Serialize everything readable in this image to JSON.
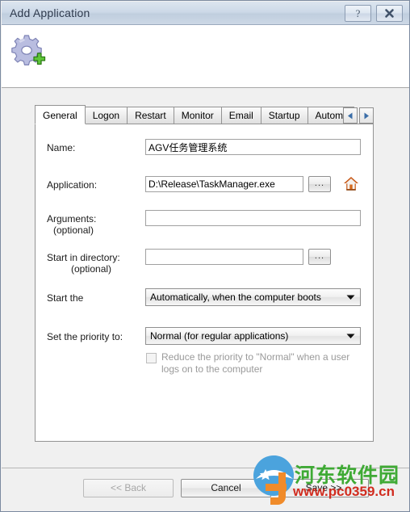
{
  "window": {
    "title": "Add Application",
    "help_button_label": "?",
    "close_button_label": "X",
    "app_icon": "gear-plus-icon"
  },
  "tabs": {
    "items": [
      {
        "label": "General",
        "selected": true
      },
      {
        "label": "Logon",
        "selected": false
      },
      {
        "label": "Restart",
        "selected": false
      },
      {
        "label": "Monitor",
        "selected": false
      },
      {
        "label": "Email",
        "selected": false
      },
      {
        "label": "Startup",
        "selected": false
      },
      {
        "label": "Automate",
        "selected": false
      }
    ],
    "scroll_left_icon": "triangle-left-icon",
    "scroll_right_icon": "triangle-right-icon"
  },
  "form": {
    "name": {
      "label": "Name:",
      "value": "AGV任务管理系统",
      "placeholder": ""
    },
    "application": {
      "label": "Application:",
      "value": "D:\\Release\\TaskManager.exe",
      "placeholder": "",
      "browse_label": "...",
      "home_icon": "home-icon"
    },
    "arguments": {
      "label": "Arguments:",
      "sub_label": "(optional)",
      "value": "",
      "placeholder": ""
    },
    "start_in_directory": {
      "label": "Start in directory:",
      "sub_label": "(optional)",
      "value": "",
      "placeholder": "",
      "browse_label": "..."
    },
    "start_the": {
      "label": "Start the",
      "value": "Automatically, when the computer boots"
    },
    "priority": {
      "label": "Set the priority to:",
      "value": "Normal (for regular applications)"
    },
    "reduce_priority": {
      "label": "Reduce the priority to \"Normal\" when a user logs on to the computer",
      "checked": false,
      "enabled": false
    }
  },
  "footer": {
    "back_label": "<< Back",
    "cancel_label": "Cancel",
    "save_label": "Save >>"
  },
  "watermark": {
    "site_name": "河东软件园",
    "url": "www.pc0359.cn"
  },
  "colors": {
    "titlebar": "#cdd9e8",
    "dialog_bg": "#f0f0f0",
    "panel_bg": "#ffffff",
    "watermark_green": "#3faa35",
    "watermark_red": "#d12c1f",
    "disabled_text": "#9a9a9a"
  }
}
